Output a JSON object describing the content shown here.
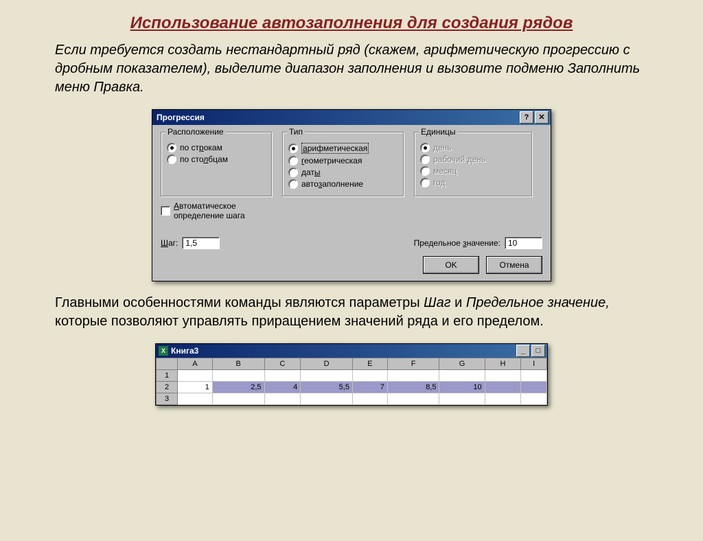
{
  "page": {
    "title": "Использование автозаполнения для создания рядов",
    "intro": "Если требуется создать нестандартный ряд (скажем, арифметическую прогрессию с дробным показателем), выделите диапазон заполнения и вызовите подменю Заполнить меню Правка.",
    "under": [
      "Главными особенностями команды являются параметры ",
      "Шаг",
      " и ",
      "Предельное значение,",
      " которые позволяют управлять приращением значений ряда и его пределом."
    ]
  },
  "dialog": {
    "title": "Прогрессия",
    "help": "?",
    "close": "✕",
    "group_layout": {
      "legend": "Расположение",
      "opt_rows": "по строкам",
      "opt_cols": "по столбцам"
    },
    "auto_step": {
      "label_l1": "Автоматическое",
      "label_l2": "определение шага"
    },
    "group_type": {
      "legend": "Тип",
      "opt_arith": "арифметическая",
      "opt_geom": "геометрическая",
      "opt_dates": "даты",
      "opt_auto": "автозаполнение"
    },
    "group_units": {
      "legend": "Единицы",
      "opt_day": "день",
      "opt_workday": "рабочий день",
      "opt_month": "месяц",
      "opt_year": "год"
    },
    "step_label": "Шаг:",
    "step_value": "1,5",
    "limit_label": "Предельное значение:",
    "limit_value": "10",
    "ok": "OK",
    "cancel": "Отмена"
  },
  "sheet": {
    "title": "Книга3",
    "min": "_",
    "max": "□",
    "cols": [
      "A",
      "B",
      "C",
      "D",
      "E",
      "F",
      "G",
      "H",
      "I"
    ],
    "rows": [
      "1",
      "2",
      "3"
    ],
    "data_row": [
      "1",
      "2,5",
      "4",
      "5,5",
      "7",
      "8,5",
      "10",
      "",
      ""
    ]
  }
}
